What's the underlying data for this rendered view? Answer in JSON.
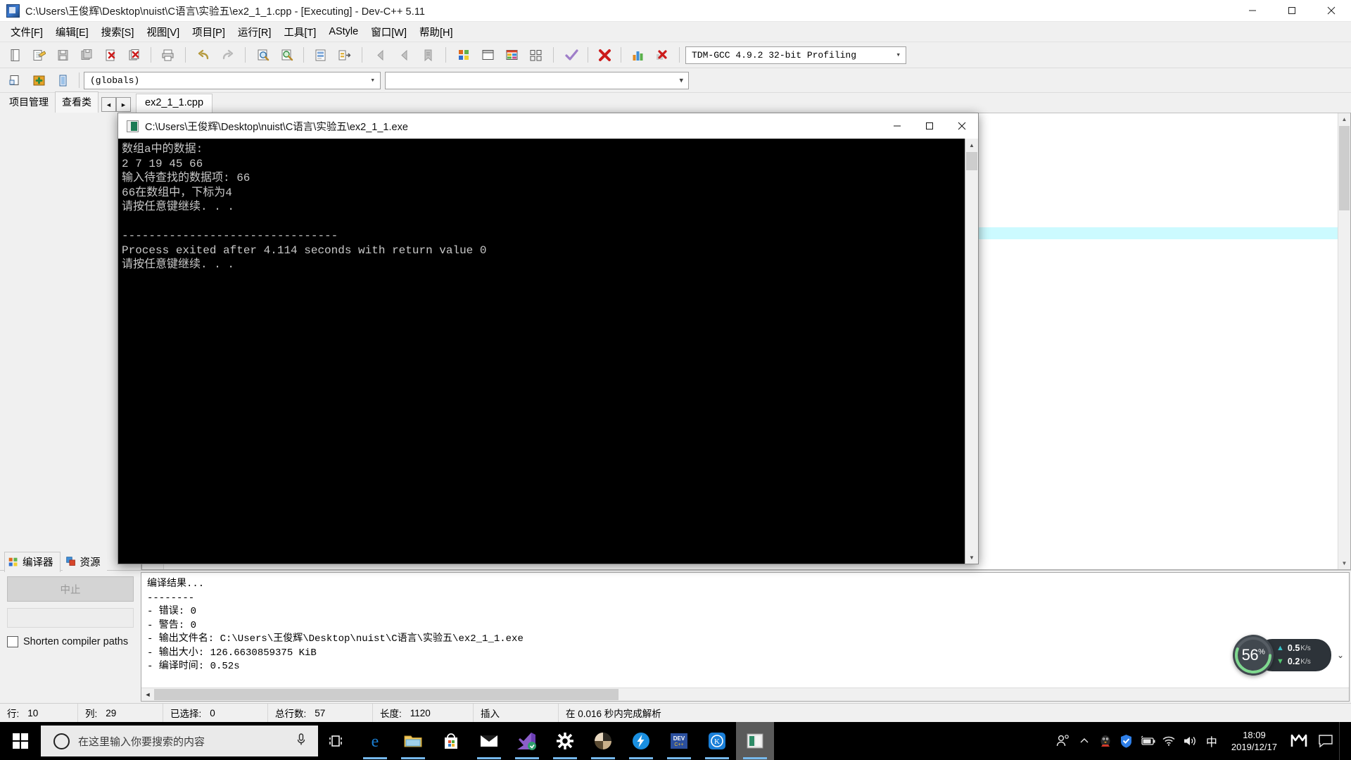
{
  "window": {
    "title": "C:\\Users\\王俊辉\\Desktop\\nuist\\C语言\\实验五\\ex2_1_1.cpp - [Executing] - Dev-C++ 5.11",
    "minimize_label": "—",
    "maximize_label": "□",
    "close_label": "✕"
  },
  "menu": {
    "items": [
      {
        "label": "文件[F]"
      },
      {
        "label": "编辑[E]"
      },
      {
        "label": "搜索[S]"
      },
      {
        "label": "视图[V]"
      },
      {
        "label": "项目[P]"
      },
      {
        "label": "运行[R]"
      },
      {
        "label": "工具[T]"
      },
      {
        "label": "AStyle"
      },
      {
        "label": "窗口[W]"
      },
      {
        "label": "帮助[H]"
      }
    ]
  },
  "toolbar": {
    "compiler_combo_value": "TDM-GCC 4.9.2 32-bit Profiling",
    "scope_combo_value": "(globals)",
    "secondary_combo_value": ""
  },
  "panel_tabs": {
    "project_manager": "项目管理",
    "class_browser": "查看类",
    "prev_label": "◄",
    "next_label": "►"
  },
  "editor": {
    "tab_label": "ex2_1_1.cpp"
  },
  "console": {
    "title": "C:\\Users\\王俊辉\\Desktop\\nuist\\C语言\\实验五\\ex2_1_1.exe",
    "minimize_label": "—",
    "maximize_label": "□",
    "close_label": "✕",
    "lines": [
      "数组a中的数据:",
      "2 7 19 45 66",
      "输入待查找的数据项: 66",
      "66在数组中，下标为4",
      "请按任意键继续. . .",
      "",
      "--------------------------------",
      "Process exited after 4.114 seconds with return value 0",
      "请按任意键继续. . ."
    ]
  },
  "log_panel": {
    "tab_compiler": "编译器",
    "tab_resource": "资源",
    "abort_button": "中止",
    "shorten_checkbox_label": "Shorten compiler paths",
    "lines": [
      "编译结果...",
      "--------",
      "- 错误: 0",
      "- 警告: 0",
      "- 输出文件名: C:\\Users\\王俊辉\\Desktop\\nuist\\C语言\\实验五\\ex2_1_1.exe",
      "- 输出大小: 126.6630859375 KiB",
      "- 编译时间: 0.52s"
    ]
  },
  "statusbar": {
    "cells": [
      {
        "label": "行:",
        "value": "10"
      },
      {
        "label": "列:",
        "value": "29"
      },
      {
        "label": "已选择:",
        "value": "0"
      },
      {
        "label": "总行数:",
        "value": "57"
      },
      {
        "label": "长度:",
        "value": "1120"
      },
      {
        "label": "插入",
        "value": ""
      },
      {
        "label": "在 0.016 秒内完成解析",
        "value": ""
      }
    ]
  },
  "net_widget": {
    "cpu_percent": "56",
    "percent_symbol": "%",
    "upload": "0.5",
    "upload_unit": "K/s",
    "download": "0.2",
    "download_unit": "K/s"
  },
  "taskbar": {
    "search_placeholder": "在这里输入你要搜索的内容",
    "time": "18:09",
    "date": "2019/12/17",
    "ime_label": "中"
  }
}
